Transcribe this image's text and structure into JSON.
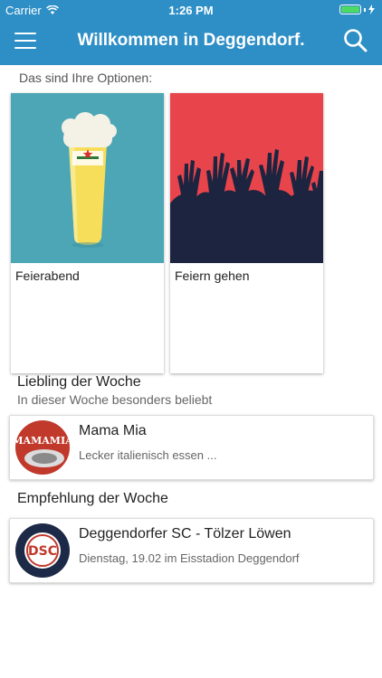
{
  "status": {
    "carrier": "Carrier",
    "time": "1:26 PM"
  },
  "header": {
    "title": "Willkommen in Deggendorf."
  },
  "intro": "Das sind Ihre Optionen:",
  "options": [
    {
      "label": "Feierabend",
      "color": "#4ca6b5"
    },
    {
      "label": "Feiern gehen",
      "color": "#e8444c"
    }
  ],
  "favorite": {
    "title": "Liebling der Woche",
    "subtitle": "In dieser Woche besonders beliebt",
    "item": {
      "name": "Mama Mia",
      "description": "Lecker italienisch essen ...",
      "logo_text": "MAMAMIA"
    }
  },
  "recommendation": {
    "title": "Empfehlung der Woche",
    "item": {
      "name": "Deggendorfer SC - Tölzer Löwen",
      "description": "Dienstag, 19.02 im Eisstadion Deggendorf",
      "logo_text": "DSC"
    }
  },
  "colors": {
    "header": "#2e8fc6",
    "battery": "#4cd964"
  }
}
